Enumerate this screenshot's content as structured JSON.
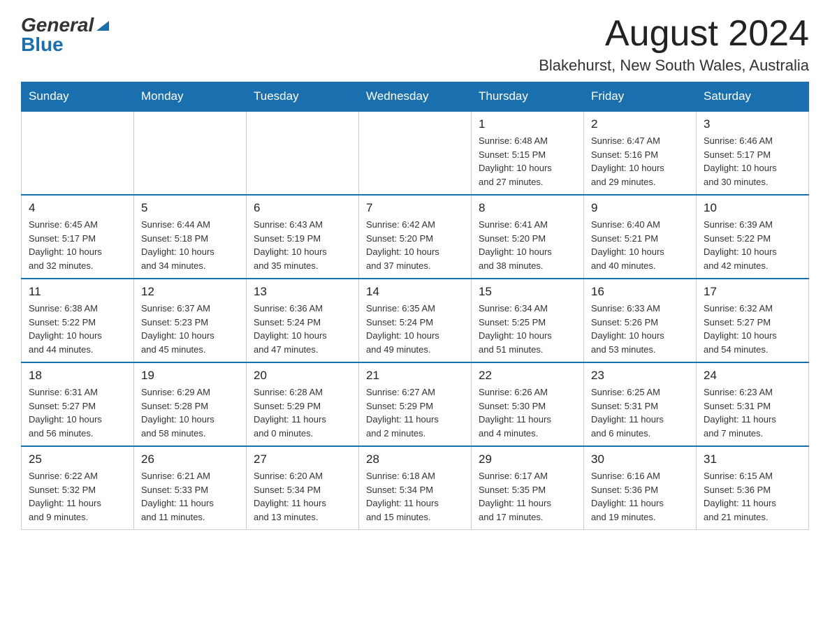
{
  "header": {
    "logo_general": "General",
    "logo_blue": "Blue",
    "month_title": "August 2024",
    "location": "Blakehurst, New South Wales, Australia"
  },
  "weekdays": [
    "Sunday",
    "Monday",
    "Tuesday",
    "Wednesday",
    "Thursday",
    "Friday",
    "Saturday"
  ],
  "weeks": [
    {
      "days": [
        {
          "number": "",
          "info": ""
        },
        {
          "number": "",
          "info": ""
        },
        {
          "number": "",
          "info": ""
        },
        {
          "number": "",
          "info": ""
        },
        {
          "number": "1",
          "info": "Sunrise: 6:48 AM\nSunset: 5:15 PM\nDaylight: 10 hours\nand 27 minutes."
        },
        {
          "number": "2",
          "info": "Sunrise: 6:47 AM\nSunset: 5:16 PM\nDaylight: 10 hours\nand 29 minutes."
        },
        {
          "number": "3",
          "info": "Sunrise: 6:46 AM\nSunset: 5:17 PM\nDaylight: 10 hours\nand 30 minutes."
        }
      ]
    },
    {
      "days": [
        {
          "number": "4",
          "info": "Sunrise: 6:45 AM\nSunset: 5:17 PM\nDaylight: 10 hours\nand 32 minutes."
        },
        {
          "number": "5",
          "info": "Sunrise: 6:44 AM\nSunset: 5:18 PM\nDaylight: 10 hours\nand 34 minutes."
        },
        {
          "number": "6",
          "info": "Sunrise: 6:43 AM\nSunset: 5:19 PM\nDaylight: 10 hours\nand 35 minutes."
        },
        {
          "number": "7",
          "info": "Sunrise: 6:42 AM\nSunset: 5:20 PM\nDaylight: 10 hours\nand 37 minutes."
        },
        {
          "number": "8",
          "info": "Sunrise: 6:41 AM\nSunset: 5:20 PM\nDaylight: 10 hours\nand 38 minutes."
        },
        {
          "number": "9",
          "info": "Sunrise: 6:40 AM\nSunset: 5:21 PM\nDaylight: 10 hours\nand 40 minutes."
        },
        {
          "number": "10",
          "info": "Sunrise: 6:39 AM\nSunset: 5:22 PM\nDaylight: 10 hours\nand 42 minutes."
        }
      ]
    },
    {
      "days": [
        {
          "number": "11",
          "info": "Sunrise: 6:38 AM\nSunset: 5:22 PM\nDaylight: 10 hours\nand 44 minutes."
        },
        {
          "number": "12",
          "info": "Sunrise: 6:37 AM\nSunset: 5:23 PM\nDaylight: 10 hours\nand 45 minutes."
        },
        {
          "number": "13",
          "info": "Sunrise: 6:36 AM\nSunset: 5:24 PM\nDaylight: 10 hours\nand 47 minutes."
        },
        {
          "number": "14",
          "info": "Sunrise: 6:35 AM\nSunset: 5:24 PM\nDaylight: 10 hours\nand 49 minutes."
        },
        {
          "number": "15",
          "info": "Sunrise: 6:34 AM\nSunset: 5:25 PM\nDaylight: 10 hours\nand 51 minutes."
        },
        {
          "number": "16",
          "info": "Sunrise: 6:33 AM\nSunset: 5:26 PM\nDaylight: 10 hours\nand 53 minutes."
        },
        {
          "number": "17",
          "info": "Sunrise: 6:32 AM\nSunset: 5:27 PM\nDaylight: 10 hours\nand 54 minutes."
        }
      ]
    },
    {
      "days": [
        {
          "number": "18",
          "info": "Sunrise: 6:31 AM\nSunset: 5:27 PM\nDaylight: 10 hours\nand 56 minutes."
        },
        {
          "number": "19",
          "info": "Sunrise: 6:29 AM\nSunset: 5:28 PM\nDaylight: 10 hours\nand 58 minutes."
        },
        {
          "number": "20",
          "info": "Sunrise: 6:28 AM\nSunset: 5:29 PM\nDaylight: 11 hours\nand 0 minutes."
        },
        {
          "number": "21",
          "info": "Sunrise: 6:27 AM\nSunset: 5:29 PM\nDaylight: 11 hours\nand 2 minutes."
        },
        {
          "number": "22",
          "info": "Sunrise: 6:26 AM\nSunset: 5:30 PM\nDaylight: 11 hours\nand 4 minutes."
        },
        {
          "number": "23",
          "info": "Sunrise: 6:25 AM\nSunset: 5:31 PM\nDaylight: 11 hours\nand 6 minutes."
        },
        {
          "number": "24",
          "info": "Sunrise: 6:23 AM\nSunset: 5:31 PM\nDaylight: 11 hours\nand 7 minutes."
        }
      ]
    },
    {
      "days": [
        {
          "number": "25",
          "info": "Sunrise: 6:22 AM\nSunset: 5:32 PM\nDaylight: 11 hours\nand 9 minutes."
        },
        {
          "number": "26",
          "info": "Sunrise: 6:21 AM\nSunset: 5:33 PM\nDaylight: 11 hours\nand 11 minutes."
        },
        {
          "number": "27",
          "info": "Sunrise: 6:20 AM\nSunset: 5:34 PM\nDaylight: 11 hours\nand 13 minutes."
        },
        {
          "number": "28",
          "info": "Sunrise: 6:18 AM\nSunset: 5:34 PM\nDaylight: 11 hours\nand 15 minutes."
        },
        {
          "number": "29",
          "info": "Sunrise: 6:17 AM\nSunset: 5:35 PM\nDaylight: 11 hours\nand 17 minutes."
        },
        {
          "number": "30",
          "info": "Sunrise: 6:16 AM\nSunset: 5:36 PM\nDaylight: 11 hours\nand 19 minutes."
        },
        {
          "number": "31",
          "info": "Sunrise: 6:15 AM\nSunset: 5:36 PM\nDaylight: 11 hours\nand 21 minutes."
        }
      ]
    }
  ]
}
